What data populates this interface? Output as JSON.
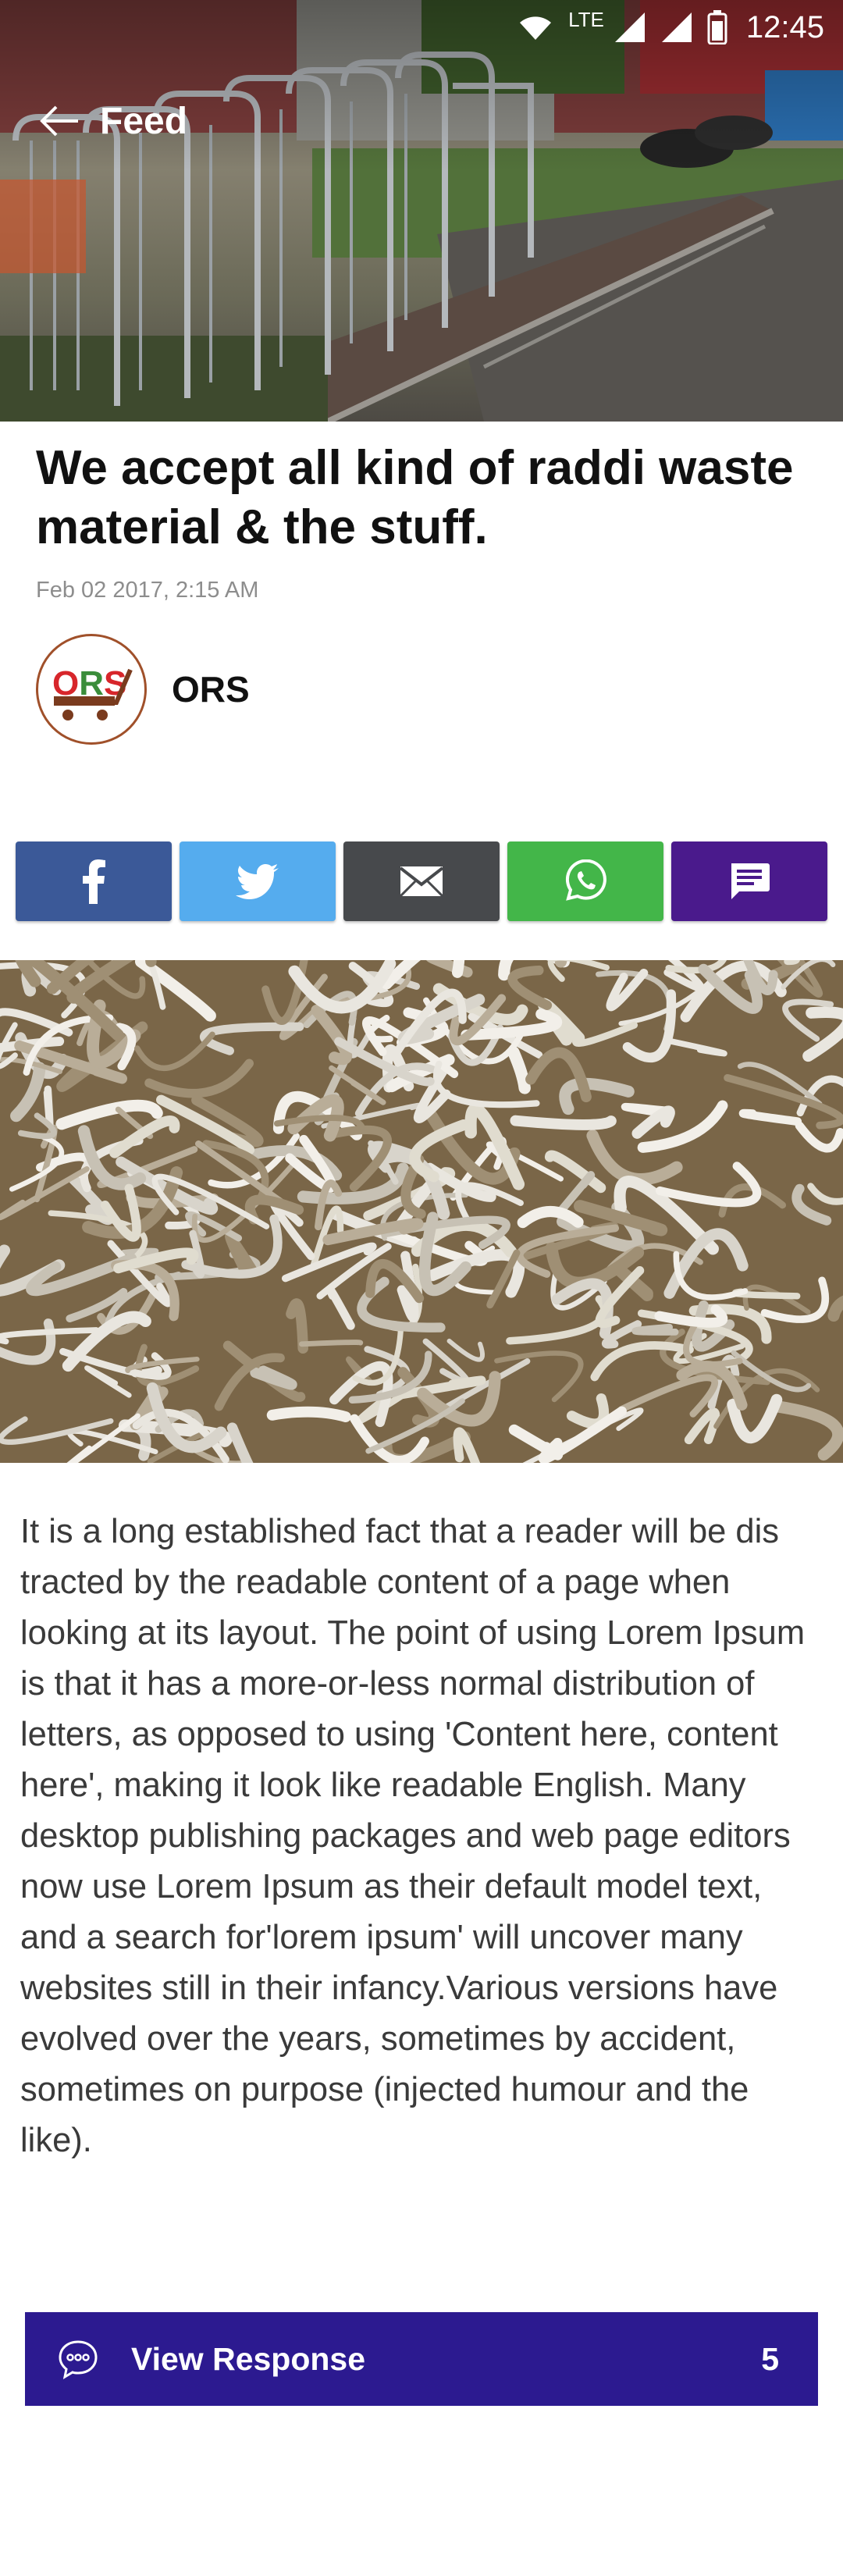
{
  "status_bar": {
    "network": "LTE",
    "time": "12:45"
  },
  "app_bar": {
    "title": "Feed"
  },
  "article": {
    "headline": "We accept all kind of raddi waste material & the stuff.",
    "date": "Feb 02 2017, 2:15 AM",
    "author": {
      "name": "ORS",
      "logo_text": "ORS"
    },
    "body": "It is a long established fact that a reader will be dis tracted by the readable content of a page when looking at its layout. The point of using Lorem Ipsum is that it has a more-or-less normal distribution of letters, as opposed to using 'Content here, content here', making it look like readable English. Many desktop publishing packages and web page editors now use Lorem Ipsum as their default model text, and a search for'lorem ipsum' will uncover many websites still in their infancy.Various versions have evolved over the years, sometimes by accident, sometimes on purpose (injected humour and the like)."
  },
  "share": {
    "buttons": [
      {
        "name": "facebook",
        "icon": "facebook-icon",
        "color": "#3b5998"
      },
      {
        "name": "twitter",
        "icon": "twitter-icon",
        "color": "#55acee"
      },
      {
        "name": "email",
        "icon": "email-icon",
        "color": "#47494c"
      },
      {
        "name": "whatsapp",
        "icon": "whatsapp-icon",
        "color": "#43b649"
      },
      {
        "name": "message",
        "icon": "message-icon",
        "color": "#4a1a8c"
      }
    ]
  },
  "responses": {
    "label": "View Response",
    "count": "5",
    "color": "#2c1a90"
  }
}
